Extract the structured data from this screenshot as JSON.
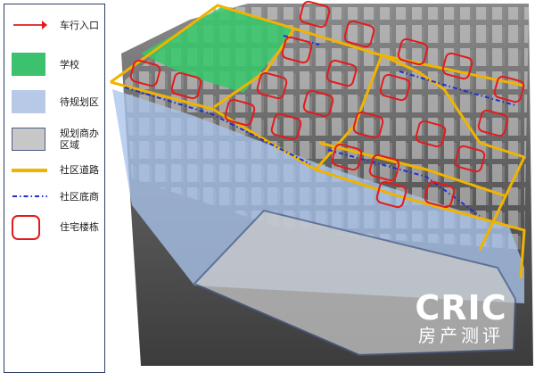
{
  "legend": {
    "items": [
      {
        "key": "entrance",
        "label": "车行入口",
        "color": "#e31b1b"
      },
      {
        "key": "school",
        "label": "学校",
        "color": "#3cc16f"
      },
      {
        "key": "planned",
        "label": "待规划区",
        "color": "#b7c9e6"
      },
      {
        "key": "commercial",
        "label": "规划商办区域",
        "color": "#c7c7c7"
      },
      {
        "key": "road",
        "label": "社区道路",
        "color": "#f0b400"
      },
      {
        "key": "shops",
        "label": "社区底商",
        "color": "#1f2fd1"
      },
      {
        "key": "building",
        "label": "住宅楼栋",
        "color": "#e31b1b"
      }
    ]
  },
  "watermark": {
    "brand": "CRIC",
    "subtitle": "房产测评"
  },
  "map": {
    "icons": [
      "entrance-arrow-icon",
      "school-area",
      "planned-area",
      "commercial-area",
      "road-line",
      "shop-dash-line",
      "building-marker"
    ]
  }
}
